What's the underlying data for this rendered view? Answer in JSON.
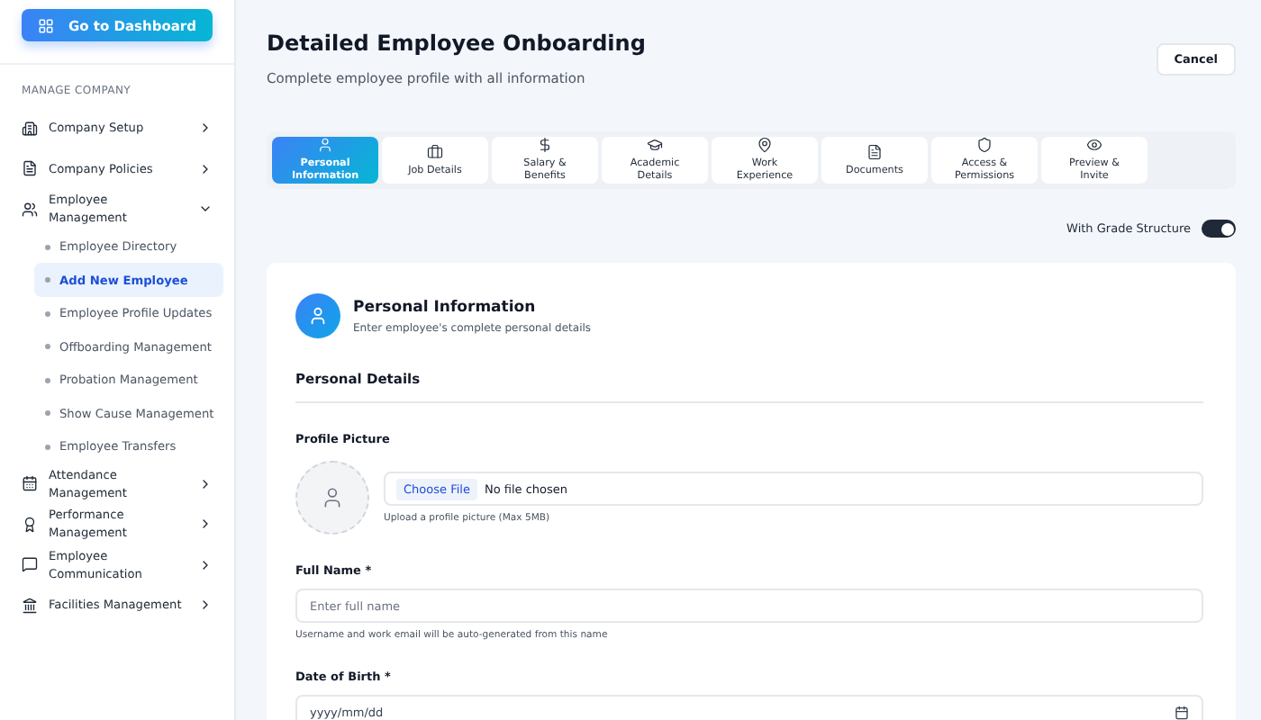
{
  "sidebar": {
    "dashboard_button": "Go to Dashboard",
    "section_label": "MANAGE COMPANY",
    "items": [
      {
        "label": "Company Setup",
        "expanded": false
      },
      {
        "label": "Company Policies",
        "expanded": false
      },
      {
        "label": "Employee Management",
        "expanded": true,
        "children": [
          {
            "label": "Employee Directory",
            "selected": false
          },
          {
            "label": "Add New Employee",
            "selected": true
          },
          {
            "label": "Employee Profile Updates",
            "selected": false
          },
          {
            "label": "Offboarding Management",
            "selected": false
          },
          {
            "label": "Probation Management",
            "selected": false
          },
          {
            "label": "Show Cause Management",
            "selected": false
          },
          {
            "label": "Employee Transfers",
            "selected": false
          }
        ]
      },
      {
        "label": "Attendance Management",
        "expanded": false
      },
      {
        "label": "Performance Management",
        "expanded": false
      },
      {
        "label": "Employee Communication",
        "expanded": false
      },
      {
        "label": "Facilities Management",
        "expanded": false
      }
    ]
  },
  "header": {
    "title": "Detailed Employee Onboarding",
    "subtitle": "Complete employee profile with all information",
    "cancel_button": "Cancel"
  },
  "tabs": [
    {
      "label": "Personal Information",
      "selected": true
    },
    {
      "label": "Job Details",
      "selected": false
    },
    {
      "label": "Salary & Benefits",
      "selected": false
    },
    {
      "label": "Academic Details",
      "selected": false
    },
    {
      "label": "Work Experience",
      "selected": false
    },
    {
      "label": "Documents",
      "selected": false
    },
    {
      "label": "Access & Permissions",
      "selected": false
    },
    {
      "label": "Preview & Invite",
      "selected": false
    }
  ],
  "grade_toggle": {
    "label": "With Grade Structure",
    "on": true
  },
  "card": {
    "title": "Personal Information",
    "subtitle": "Enter employee's complete personal details",
    "section_title": "Personal Details",
    "profile_picture": {
      "label": "Profile Picture",
      "button": "Choose File",
      "status": "No file chosen",
      "hint": "Upload a profile picture (Max 5MB)"
    },
    "full_name": {
      "label": "Full Name *",
      "placeholder": "Enter full name",
      "hint": "Username and work email will be auto-generated from this name"
    },
    "date_of_birth": {
      "label": "Date of Birth *",
      "placeholder": "yyyy/mm/dd"
    }
  }
}
